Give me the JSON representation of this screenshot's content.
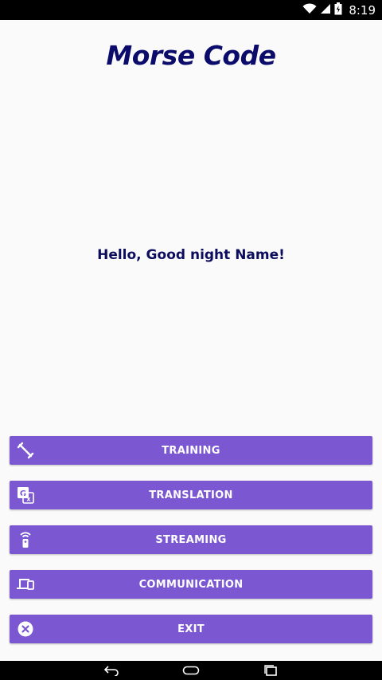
{
  "status_bar": {
    "time": "8:19",
    "icons": [
      "wifi-icon",
      "cellular-signal-icon",
      "battery-icon"
    ]
  },
  "app": {
    "title": "Morse Code",
    "greeting": "Hello, Good night Name!"
  },
  "menu": {
    "buttons": [
      {
        "label": "TRAINING",
        "icon": "dumbbell-icon"
      },
      {
        "label": "TRANSLATION",
        "icon": "translate-icon"
      },
      {
        "label": "STREAMING",
        "icon": "remote-icon"
      },
      {
        "label": "COMMUNICATION",
        "icon": "devices-icon"
      },
      {
        "label": "EXIT",
        "icon": "cancel-icon"
      }
    ]
  },
  "colors": {
    "accent": "#7b57d1",
    "title": "#0b0b6b",
    "background": "#fafafa"
  },
  "nav_bar": {
    "icons": [
      "back-icon",
      "home-icon",
      "recents-icon"
    ]
  }
}
